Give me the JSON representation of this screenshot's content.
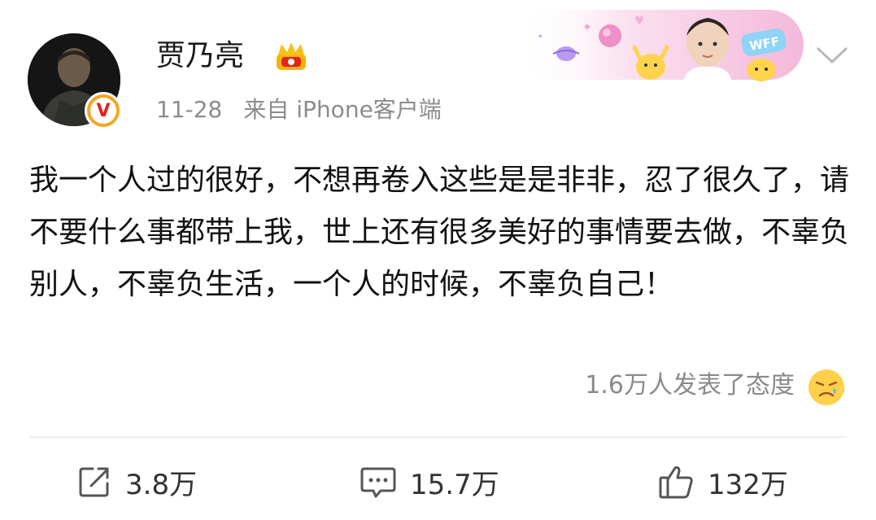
{
  "post": {
    "author": "贾乃亮",
    "date": "11-28",
    "source": "来自 iPhone客户端",
    "content": "我一个人过的很好，不想再卷入这些是是非非，忍了很久了，请不要什么事都带上我，世上还有很多美好的事情要去做，不辜负别人，不辜负生活，一个人的时候，不辜负自己！",
    "reactions_text": "1.6万人发表了态度"
  },
  "banner": {
    "badge_text": "WFF"
  },
  "actions": {
    "repost_count": "3.8万",
    "comment_count": "15.7万",
    "like_count": "132万"
  },
  "colors": {
    "text_primary": "#111111",
    "text_secondary": "#8c8c8c",
    "verified_badge": "#f5a623",
    "banner_pink": "#f7c9e3"
  }
}
